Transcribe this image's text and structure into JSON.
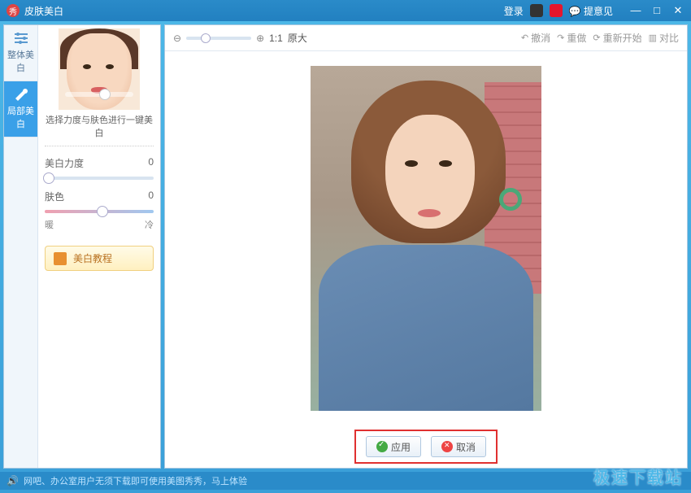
{
  "titlebar": {
    "title": "皮肤美白",
    "login": "登录",
    "feedback": "提意见"
  },
  "left_tabs": {
    "overall": "整体美白",
    "local": "局部美白"
  },
  "panel": {
    "instruction": "选择力度与肤色进行一键美白",
    "strength_label": "美白力度",
    "strength_value": "0",
    "tone_label": "肤色",
    "tone_value": "0",
    "tone_warm": "暖",
    "tone_cool": "冷",
    "tutorial": "美白教程"
  },
  "toolbar": {
    "zoom_ratio": "1:1",
    "zoom_original": "原大",
    "undo": "撤消",
    "redo": "重做",
    "restart": "重新开始",
    "compare": "对比"
  },
  "actions": {
    "apply": "应用",
    "cancel": "取消"
  },
  "footer": {
    "message": "网吧、办公室用户无须下载即可使用美图秀秀，马上体验"
  },
  "watermark": "极速下载站"
}
